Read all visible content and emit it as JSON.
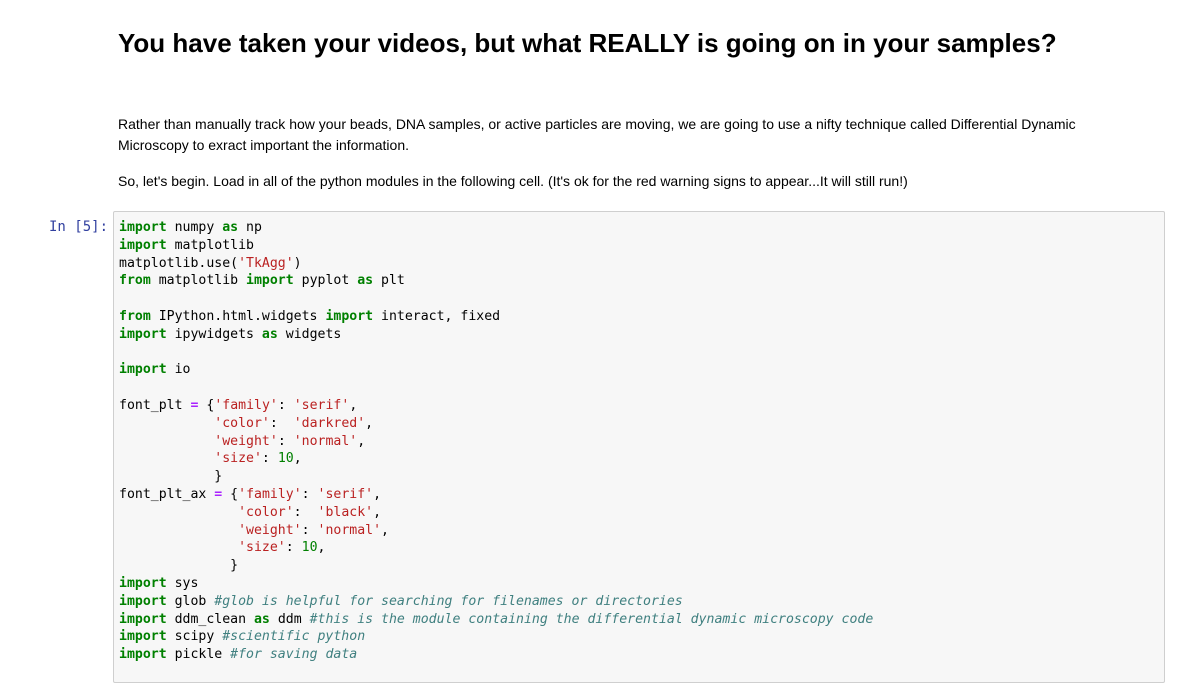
{
  "header": {
    "title": "You have taken your videos, but what REALLY is going on in your samples?"
  },
  "intro": {
    "paragraph1": "Rather than manually track how your beads, DNA samples, or active particles are moving, we are going to use a nifty technique called Differential Dynamic Microscopy to exract important the information.",
    "paragraph2": "So, let's begin. Load in all of the python modules in the following cell. (It's ok for the red warning signs to appear...It will still run!)"
  },
  "cell": {
    "prompt": "In [5]:",
    "lines": [
      [
        {
          "t": "import",
          "c": "kw"
        },
        {
          "t": " numpy "
        },
        {
          "t": "as",
          "c": "kw"
        },
        {
          "t": " np"
        }
      ],
      [
        {
          "t": "import",
          "c": "kw"
        },
        {
          "t": " matplotlib"
        }
      ],
      [
        {
          "t": "matplotlib.use("
        },
        {
          "t": "'TkAgg'",
          "c": "st"
        },
        {
          "t": ")"
        }
      ],
      [
        {
          "t": "from",
          "c": "kw"
        },
        {
          "t": " matplotlib "
        },
        {
          "t": "import",
          "c": "kw"
        },
        {
          "t": " pyplot "
        },
        {
          "t": "as",
          "c": "kw"
        },
        {
          "t": " plt"
        }
      ],
      [
        {
          "t": ""
        }
      ],
      [
        {
          "t": "from",
          "c": "kw"
        },
        {
          "t": " IPython.html.widgets "
        },
        {
          "t": "import",
          "c": "kw"
        },
        {
          "t": " interact, fixed"
        }
      ],
      [
        {
          "t": "import",
          "c": "kw"
        },
        {
          "t": " ipywidgets "
        },
        {
          "t": "as",
          "c": "kw"
        },
        {
          "t": " widgets"
        }
      ],
      [
        {
          "t": ""
        }
      ],
      [
        {
          "t": "import",
          "c": "kw"
        },
        {
          "t": " io"
        }
      ],
      [
        {
          "t": ""
        }
      ],
      [
        {
          "t": "font_plt "
        },
        {
          "t": "=",
          "c": "op"
        },
        {
          "t": " {"
        },
        {
          "t": "'family'",
          "c": "st"
        },
        {
          "t": ": "
        },
        {
          "t": "'serif'",
          "c": "st"
        },
        {
          "t": ","
        }
      ],
      [
        {
          "t": "            "
        },
        {
          "t": "'color'",
          "c": "st"
        },
        {
          "t": ":  "
        },
        {
          "t": "'darkred'",
          "c": "st"
        },
        {
          "t": ","
        }
      ],
      [
        {
          "t": "            "
        },
        {
          "t": "'weight'",
          "c": "st"
        },
        {
          "t": ": "
        },
        {
          "t": "'normal'",
          "c": "st"
        },
        {
          "t": ","
        }
      ],
      [
        {
          "t": "            "
        },
        {
          "t": "'size'",
          "c": "st"
        },
        {
          "t": ": "
        },
        {
          "t": "10",
          "c": "nm"
        },
        {
          "t": ","
        }
      ],
      [
        {
          "t": "            }"
        }
      ],
      [
        {
          "t": "font_plt_ax "
        },
        {
          "t": "=",
          "c": "op"
        },
        {
          "t": " {"
        },
        {
          "t": "'family'",
          "c": "st"
        },
        {
          "t": ": "
        },
        {
          "t": "'serif'",
          "c": "st"
        },
        {
          "t": ","
        }
      ],
      [
        {
          "t": "               "
        },
        {
          "t": "'color'",
          "c": "st"
        },
        {
          "t": ":  "
        },
        {
          "t": "'black'",
          "c": "st"
        },
        {
          "t": ","
        }
      ],
      [
        {
          "t": "               "
        },
        {
          "t": "'weight'",
          "c": "st"
        },
        {
          "t": ": "
        },
        {
          "t": "'normal'",
          "c": "st"
        },
        {
          "t": ","
        }
      ],
      [
        {
          "t": "               "
        },
        {
          "t": "'size'",
          "c": "st"
        },
        {
          "t": ": "
        },
        {
          "t": "10",
          "c": "nm"
        },
        {
          "t": ","
        }
      ],
      [
        {
          "t": "              }"
        }
      ],
      [
        {
          "t": "import",
          "c": "kw"
        },
        {
          "t": " sys"
        }
      ],
      [
        {
          "t": "import",
          "c": "kw"
        },
        {
          "t": " glob "
        },
        {
          "t": "#glob is helpful for searching for filenames or directories",
          "c": "cm"
        }
      ],
      [
        {
          "t": "import",
          "c": "kw"
        },
        {
          "t": " ddm_clean "
        },
        {
          "t": "as",
          "c": "kw"
        },
        {
          "t": " ddm "
        },
        {
          "t": "#this is the module containing the differential dynamic microscopy code",
          "c": "cm"
        }
      ],
      [
        {
          "t": "import",
          "c": "kw"
        },
        {
          "t": " scipy "
        },
        {
          "t": "#scientific python",
          "c": "cm"
        }
      ],
      [
        {
          "t": "import",
          "c": "kw"
        },
        {
          "t": " pickle "
        },
        {
          "t": "#for saving data",
          "c": "cm"
        }
      ]
    ]
  }
}
